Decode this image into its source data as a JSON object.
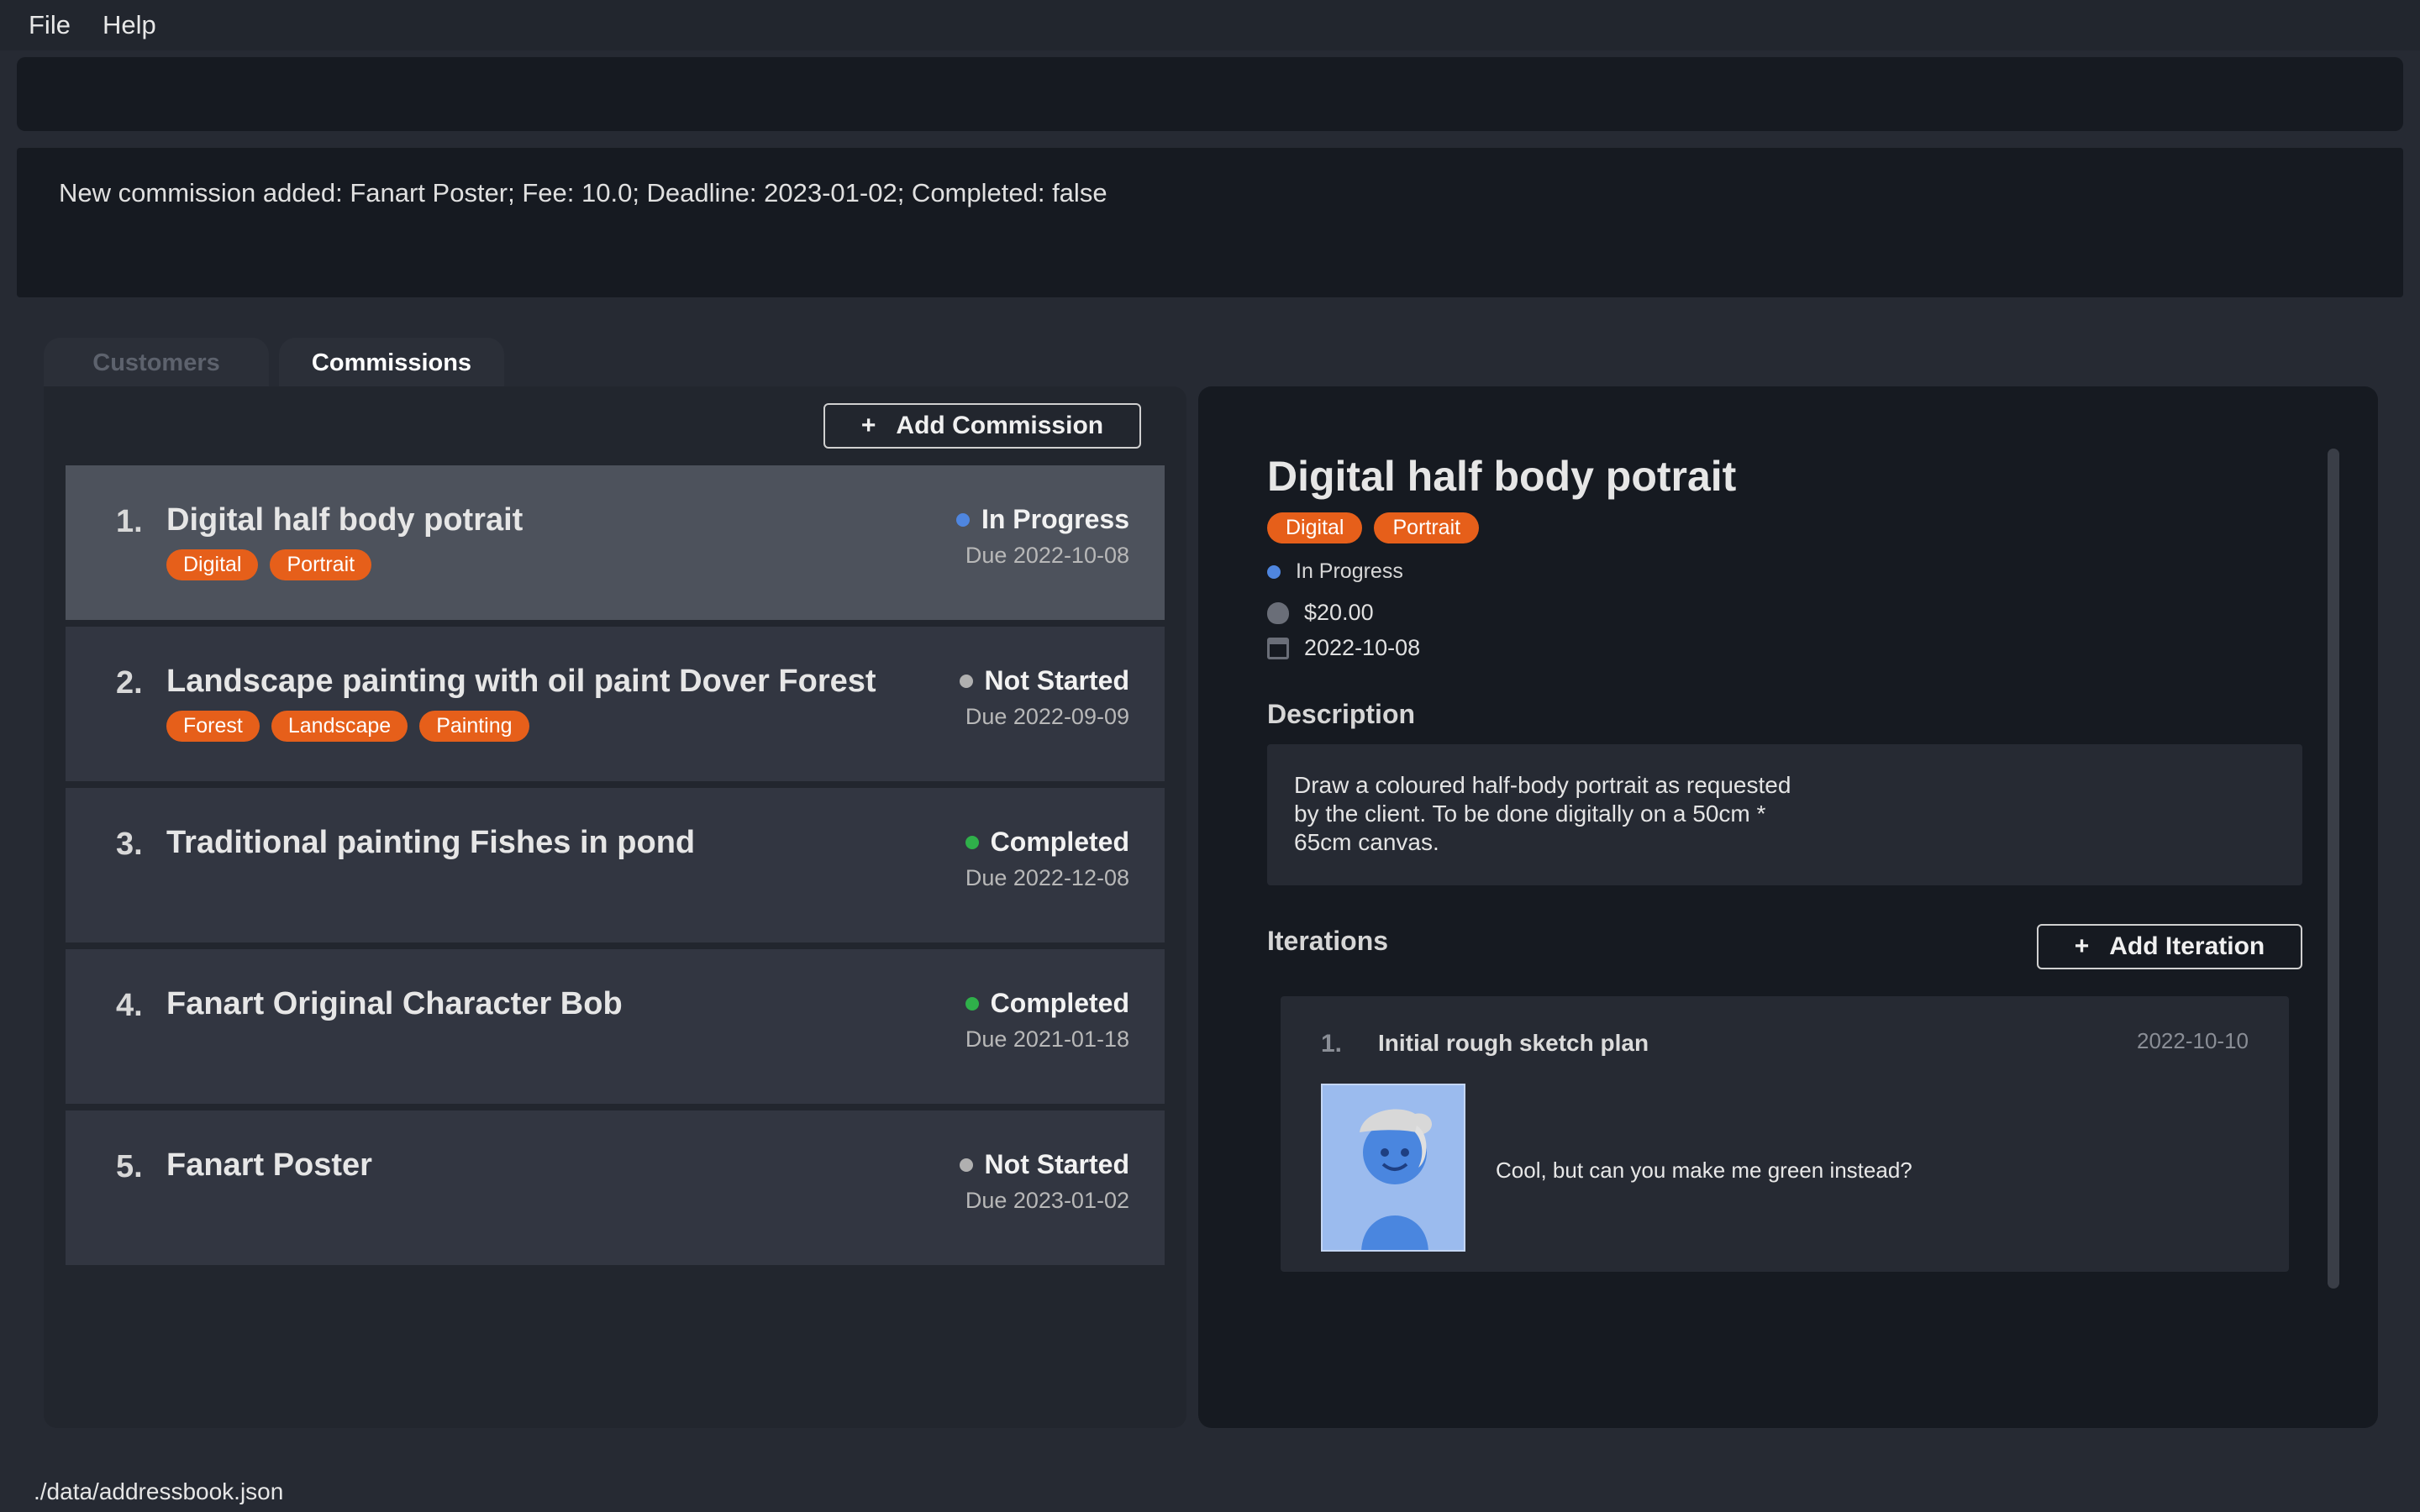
{
  "menu": {
    "file": "File",
    "help": "Help"
  },
  "command": {
    "value": ""
  },
  "result": {
    "message": "New commission added: Fanart Poster; Fee: 10.0; Deadline: 2023-01-02; Completed: false"
  },
  "tabs": [
    {
      "label": "Customers"
    },
    {
      "label": "Commissions"
    }
  ],
  "toolbar": {
    "add_commission_plus": "+",
    "add_commission_label": "Add Commission"
  },
  "colors": {
    "in_progress": "#4f86df",
    "not_started": "#b0b0b0",
    "completed": "#2fb04a",
    "tag": "#e65f1a"
  },
  "commissions": [
    {
      "index": "1.",
      "title": "Digital half body potrait",
      "tags": [
        "Digital",
        "Portrait"
      ],
      "status": "In Progress",
      "due": "Due 2022-10-08"
    },
    {
      "index": "2.",
      "title": "Landscape painting with oil paint Dover Forest",
      "tags": [
        "Forest",
        "Landscape",
        "Painting"
      ],
      "status": "Not Started",
      "due": "Due 2022-09-09"
    },
    {
      "index": "3.",
      "title": "Traditional painting Fishes in pond",
      "tags": [],
      "status": "Completed",
      "due": "Due 2022-12-08"
    },
    {
      "index": "4.",
      "title": "Fanart Original Character Bob",
      "tags": [],
      "status": "Completed",
      "due": "Due 2021-01-18"
    },
    {
      "index": "5.",
      "title": "Fanart Poster",
      "tags": [],
      "status": "Not Started",
      "due": "Due 2023-01-02"
    }
  ],
  "detail": {
    "title": "Digital half body potrait",
    "tags": [
      "Digital",
      "Portrait"
    ],
    "status": "In Progress",
    "fee": "$20.00",
    "deadline": "2022-10-08",
    "description_label": "Description",
    "description": "Draw a coloured half-body portrait as requested by the client. To be done digitally on a 50cm * 65cm canvas.",
    "iterations_label": "Iterations",
    "add_iteration_plus": "+",
    "add_iteration_label": "Add Iteration",
    "iterations": [
      {
        "index": "1.",
        "title": "Initial rough sketch plan",
        "date": "2022-10-10",
        "comment": "Cool, but can you make me green instead?"
      }
    ]
  },
  "statusbar": {
    "path": "./data/addressbook.json"
  }
}
